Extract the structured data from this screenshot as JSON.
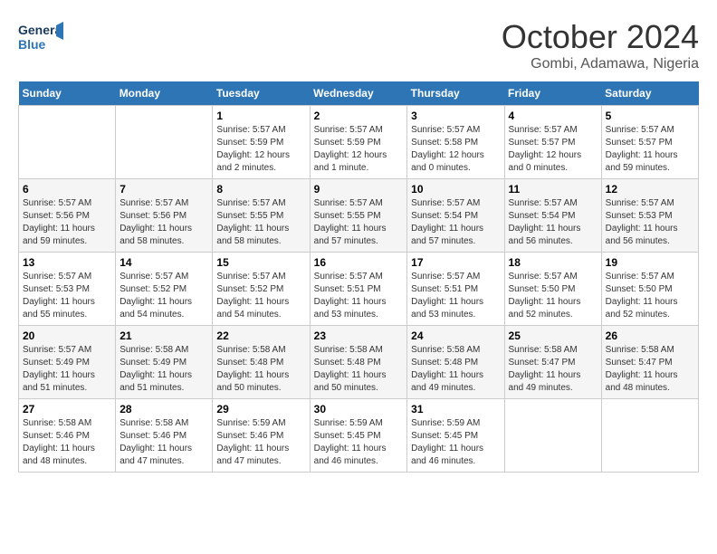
{
  "header": {
    "logo_line1": "General",
    "logo_line2": "Blue",
    "month": "October 2024",
    "location": "Gombi, Adamawa, Nigeria"
  },
  "weekdays": [
    "Sunday",
    "Monday",
    "Tuesday",
    "Wednesday",
    "Thursday",
    "Friday",
    "Saturday"
  ],
  "weeks": [
    [
      {
        "day": "",
        "info": ""
      },
      {
        "day": "",
        "info": ""
      },
      {
        "day": "1",
        "info": "Sunrise: 5:57 AM\nSunset: 5:59 PM\nDaylight: 12 hours\nand 2 minutes."
      },
      {
        "day": "2",
        "info": "Sunrise: 5:57 AM\nSunset: 5:59 PM\nDaylight: 12 hours\nand 1 minute."
      },
      {
        "day": "3",
        "info": "Sunrise: 5:57 AM\nSunset: 5:58 PM\nDaylight: 12 hours\nand 0 minutes."
      },
      {
        "day": "4",
        "info": "Sunrise: 5:57 AM\nSunset: 5:57 PM\nDaylight: 12 hours\nand 0 minutes."
      },
      {
        "day": "5",
        "info": "Sunrise: 5:57 AM\nSunset: 5:57 PM\nDaylight: 11 hours\nand 59 minutes."
      }
    ],
    [
      {
        "day": "6",
        "info": "Sunrise: 5:57 AM\nSunset: 5:56 PM\nDaylight: 11 hours\nand 59 minutes."
      },
      {
        "day": "7",
        "info": "Sunrise: 5:57 AM\nSunset: 5:56 PM\nDaylight: 11 hours\nand 58 minutes."
      },
      {
        "day": "8",
        "info": "Sunrise: 5:57 AM\nSunset: 5:55 PM\nDaylight: 11 hours\nand 58 minutes."
      },
      {
        "day": "9",
        "info": "Sunrise: 5:57 AM\nSunset: 5:55 PM\nDaylight: 11 hours\nand 57 minutes."
      },
      {
        "day": "10",
        "info": "Sunrise: 5:57 AM\nSunset: 5:54 PM\nDaylight: 11 hours\nand 57 minutes."
      },
      {
        "day": "11",
        "info": "Sunrise: 5:57 AM\nSunset: 5:54 PM\nDaylight: 11 hours\nand 56 minutes."
      },
      {
        "day": "12",
        "info": "Sunrise: 5:57 AM\nSunset: 5:53 PM\nDaylight: 11 hours\nand 56 minutes."
      }
    ],
    [
      {
        "day": "13",
        "info": "Sunrise: 5:57 AM\nSunset: 5:53 PM\nDaylight: 11 hours\nand 55 minutes."
      },
      {
        "day": "14",
        "info": "Sunrise: 5:57 AM\nSunset: 5:52 PM\nDaylight: 11 hours\nand 54 minutes."
      },
      {
        "day": "15",
        "info": "Sunrise: 5:57 AM\nSunset: 5:52 PM\nDaylight: 11 hours\nand 54 minutes."
      },
      {
        "day": "16",
        "info": "Sunrise: 5:57 AM\nSunset: 5:51 PM\nDaylight: 11 hours\nand 53 minutes."
      },
      {
        "day": "17",
        "info": "Sunrise: 5:57 AM\nSunset: 5:51 PM\nDaylight: 11 hours\nand 53 minutes."
      },
      {
        "day": "18",
        "info": "Sunrise: 5:57 AM\nSunset: 5:50 PM\nDaylight: 11 hours\nand 52 minutes."
      },
      {
        "day": "19",
        "info": "Sunrise: 5:57 AM\nSunset: 5:50 PM\nDaylight: 11 hours\nand 52 minutes."
      }
    ],
    [
      {
        "day": "20",
        "info": "Sunrise: 5:57 AM\nSunset: 5:49 PM\nDaylight: 11 hours\nand 51 minutes."
      },
      {
        "day": "21",
        "info": "Sunrise: 5:58 AM\nSunset: 5:49 PM\nDaylight: 11 hours\nand 51 minutes."
      },
      {
        "day": "22",
        "info": "Sunrise: 5:58 AM\nSunset: 5:48 PM\nDaylight: 11 hours\nand 50 minutes."
      },
      {
        "day": "23",
        "info": "Sunrise: 5:58 AM\nSunset: 5:48 PM\nDaylight: 11 hours\nand 50 minutes."
      },
      {
        "day": "24",
        "info": "Sunrise: 5:58 AM\nSunset: 5:48 PM\nDaylight: 11 hours\nand 49 minutes."
      },
      {
        "day": "25",
        "info": "Sunrise: 5:58 AM\nSunset: 5:47 PM\nDaylight: 11 hours\nand 49 minutes."
      },
      {
        "day": "26",
        "info": "Sunrise: 5:58 AM\nSunset: 5:47 PM\nDaylight: 11 hours\nand 48 minutes."
      }
    ],
    [
      {
        "day": "27",
        "info": "Sunrise: 5:58 AM\nSunset: 5:46 PM\nDaylight: 11 hours\nand 48 minutes."
      },
      {
        "day": "28",
        "info": "Sunrise: 5:58 AM\nSunset: 5:46 PM\nDaylight: 11 hours\nand 47 minutes."
      },
      {
        "day": "29",
        "info": "Sunrise: 5:59 AM\nSunset: 5:46 PM\nDaylight: 11 hours\nand 47 minutes."
      },
      {
        "day": "30",
        "info": "Sunrise: 5:59 AM\nSunset: 5:45 PM\nDaylight: 11 hours\nand 46 minutes."
      },
      {
        "day": "31",
        "info": "Sunrise: 5:59 AM\nSunset: 5:45 PM\nDaylight: 11 hours\nand 46 minutes."
      },
      {
        "day": "",
        "info": ""
      },
      {
        "day": "",
        "info": ""
      }
    ]
  ]
}
